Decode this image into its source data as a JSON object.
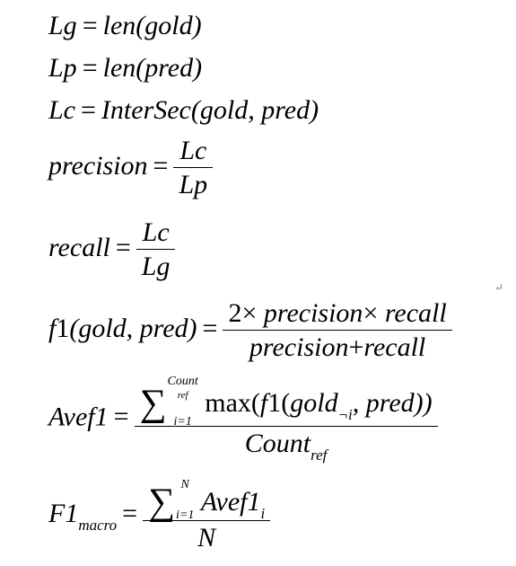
{
  "equations": {
    "lg": {
      "lhs": "Lg",
      "eq": "=",
      "rhs": "len(gold)"
    },
    "lp": {
      "lhs": "Lp",
      "eq": "=",
      "rhs": "len(pred)"
    },
    "lc": {
      "lhs": "Lc",
      "eq": "=",
      "rhs": "InterSec(gold, pred)"
    },
    "precision": {
      "lhs": "precision",
      "eq": "=",
      "num": "Lc",
      "den": "Lp"
    },
    "recall": {
      "lhs": "recall",
      "eq": "=",
      "num": "Lc",
      "den": "Lg"
    },
    "f1": {
      "lhs_f": "f",
      "lhs_1": "1",
      "lhs_args": "(gold, pred)",
      "eq": "=",
      "num_2": "2",
      "times": "×",
      "num_precision": "precision",
      "num_recall": "recall",
      "den_precision": "precision",
      "plus": "+",
      "den_recall": "recall"
    },
    "avef1": {
      "lhs": "Avef1",
      "eq": "=",
      "sigma": "∑",
      "upper": "Count",
      "upper_sub": "ref",
      "lower": "i=1",
      "max": "max(",
      "f": "f",
      "one": "1",
      "open": "(",
      "gold": "gold",
      "gold_sub": "¬i",
      "rest": ", pred))",
      "den": "Count",
      "den_sub": "ref"
    },
    "f1macro": {
      "lhs": "F1",
      "lhs_sub": "macro",
      "eq": "=",
      "sigma": "∑",
      "upper": "N",
      "lower": "i=1",
      "term": "Avef1",
      "term_sub": "i",
      "den": "N"
    }
  },
  "paragraph_mark": "↵"
}
